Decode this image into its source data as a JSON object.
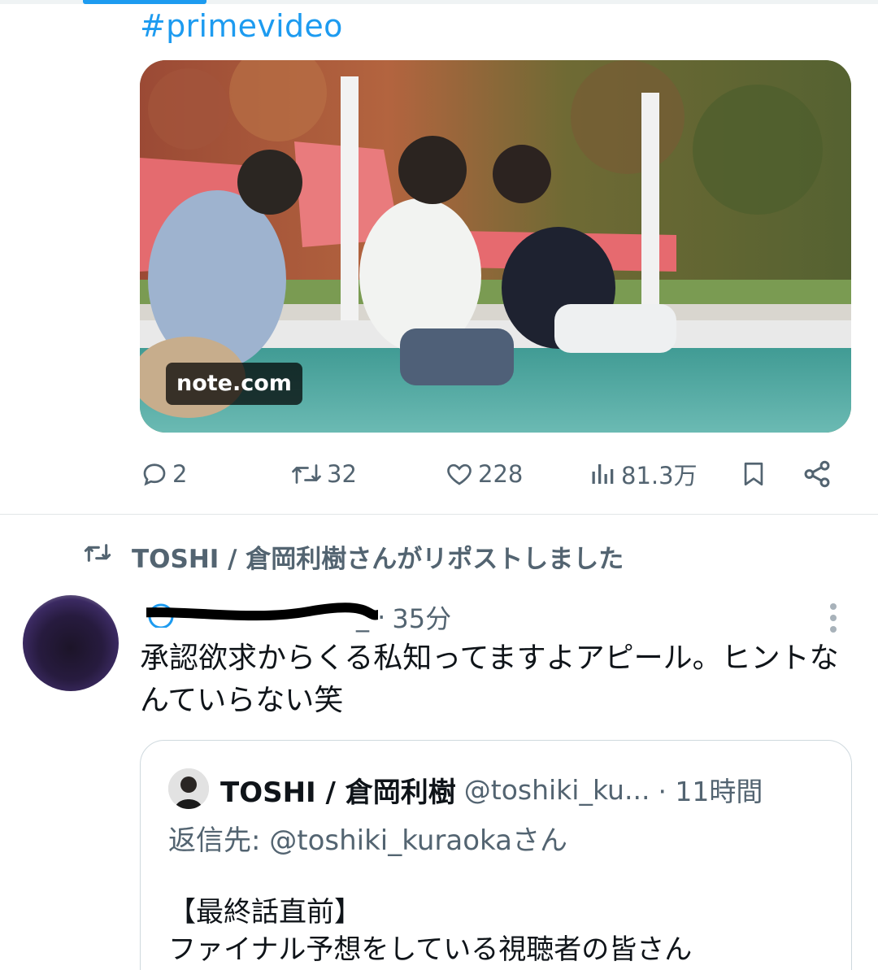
{
  "hashtag": "#primevideo",
  "media_card": {
    "source_label": "note.com"
  },
  "actions": {
    "reply_count": "2",
    "repost_count": "32",
    "like_count": "228",
    "views_count": "81.3万"
  },
  "repost_notice": {
    "text": "TOSHI / 倉岡利樹さんがリポストしました"
  },
  "tweet": {
    "handle_tail": "_ ·",
    "time": "35分",
    "text": "承認欲求からくる私知ってますよアピール。ヒントなんていらない笑"
  },
  "quote": {
    "display_name": "TOSHI / 倉岡利樹",
    "handle": "@toshiki_ku...",
    "time": "· 11時間",
    "reply_to": "返信先: @toshiki_kuraokaさん",
    "body_line1": "【最終話直前】",
    "body_line2": "ファイナル予想をしている視聴者の皆さん"
  },
  "colors": {
    "accent": "#1d9bf0",
    "muted": "#536471",
    "text": "#0f1419",
    "border": "#cfd9de"
  }
}
